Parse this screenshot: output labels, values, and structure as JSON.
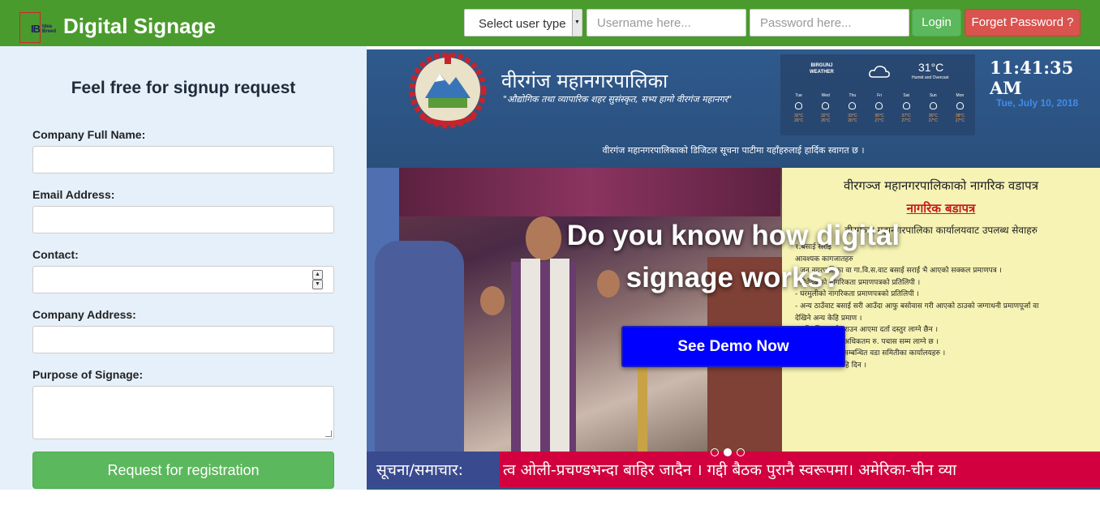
{
  "header": {
    "logo_text": "IB",
    "logo_small_text": "Idea Breed",
    "brand": "Digital Signage",
    "user_type_label": "Select user type",
    "username_placeholder": "Username here...",
    "password_placeholder": "Password here...",
    "login_label": "Login",
    "forget_label": "Forget Password ?",
    "colors": {
      "bar": "#4a9b2d",
      "login": "#5cb85c",
      "forget": "#d9534f"
    }
  },
  "signup": {
    "title": "Feel free for signup request",
    "fields": [
      {
        "label": "Company Full Name:"
      },
      {
        "label": "Email Address:"
      },
      {
        "label": "Contact:"
      },
      {
        "label": "Company Address:"
      },
      {
        "label": "Purpose of Signage:"
      }
    ],
    "submit_label": "Request for registration"
  },
  "showcase": {
    "municipality_title": "वीरगंज महानगरपालिका",
    "tagline": "\"औद्योगिक तथा व्यापारिक शहर सुसंस्कृत, सभ्य हामो वीरगंज महानगर\"",
    "weather": {
      "city": "BIRGUNJ",
      "label": "WEATHER",
      "temperature": "31°C",
      "condition": "Humid and Overcast",
      "days": [
        {
          "day": "Tue",
          "hi": "32°C",
          "lo": "26°C"
        },
        {
          "day": "Wed",
          "hi": "32°C",
          "lo": "26°C"
        },
        {
          "day": "Thu",
          "hi": "33°C",
          "lo": "26°C"
        },
        {
          "day": "Fri",
          "hi": "36°C",
          "lo": "27°C"
        },
        {
          "day": "Sat",
          "hi": "37°C",
          "lo": "27°C"
        },
        {
          "day": "Sun",
          "hi": "36°C",
          "lo": "27°C"
        },
        {
          "day": "Mon",
          "hi": "38°C",
          "lo": "27°C"
        }
      ]
    },
    "clock": "11:41:35 AM",
    "date": "Tue, July 10, 2018",
    "welcome": "वीरगंज महानगरपालिकाको डिजिटल सूचना पाटीमा यहाँहरुलाई हार्दिक स्वागत छ ।",
    "notice_title": "वीरगञ्ज महानगरपालिकाको नागरिक वडापत्र",
    "notice_subtitle": "नागरिक बडापत्र",
    "notice_line": "वीरगञ्ज महानगरपालिका कार्यालयवाट उपलब्ध सेवाहरु",
    "notice_items": [
      "१.बसाई सराई",
      "आवश्यक कागजातहरु",
      "- जुन नगरपालिका वा गा.वि.स.वाट बसाई सराई भै आएको सक्कल प्रमाणपत्र ।",
      "- निवेदकको नागरिकता प्रमाणपत्रको प्रतिलिपी ।",
      "- घरमुलीको नागरिकता प्रमाणपत्रको प्रतिलिपी ।",
      "- अन्य ठाउँवाट बसाई सरी आउँदा आफु बसोवास गरी आएको ठाउको जग्गाधनी प्रमाणपूर्जा वा",
      "  देखिने अन्य केहि प्रमाण ।",
      "  ३५ दिनभित्र दर्ता गराउन आएमा दर्ता दस्तुर लाग्ने छैन ।",
      "  सुकै दिन भए पनि अधिकतम रु. पचास सम्म लाग्ने छ ।",
      "सम्बन्धित शाखा:- सम्बन्धित वडा समितीका कार्यालयहरु ।",
      "समय अवधि :- सोहि दिन ।"
    ],
    "ticker_label": "सूचना/समाचार:",
    "ticker_text": "त्व ओली-प्रचण्डभन्दा बाहिर जादैन । गद्दी बैठक पुरानै स्वरूपमा। अमेरिका-चीन व्या",
    "overlay_heading": "Do you know how digital signage works?",
    "demo_label": "See Demo Now",
    "demo_color": "#0000ff",
    "slide_active_index": 2
  }
}
